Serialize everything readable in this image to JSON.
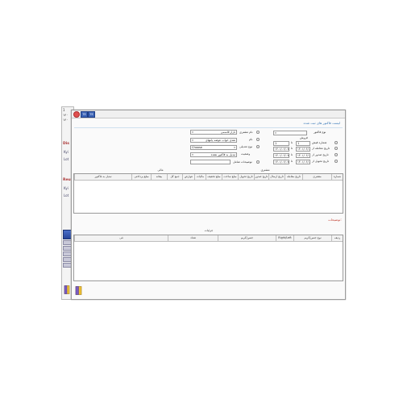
{
  "background_window": {
    "lines": [
      "1",
      "۱۴۰",
      "۱۴۰"
    ],
    "heading1": "Dis",
    "sub1a": "Kyi",
    "sub1b": "Lot",
    "heading2": "Reu",
    "sub2a": "Kyi",
    "sub2b": "Lot"
  },
  "titlebar": {
    "btn1": "TE",
    "btn2": "TE"
  },
  "window_title": "لیست فاکتور های ثبت شده",
  "filters": {
    "invoice_type_label": "نوع فاکتور",
    "invoice_type_value": "فروش",
    "invoice_number_label": "شماره فیش",
    "number_from": "1",
    "number_to": "1",
    "invoice_date_label": "تاریخ معامله از",
    "issue_date_label": "تاریخ صدور از",
    "delivery_date_label": "تاریخ تحویل از",
    "date_from": "۱۴۰۱/۰۶/۰۷",
    "date_to": "۱۴۰۱/۰۶/۰۷",
    "to_label": "تا",
    "customer_label": "نام مشتری",
    "customer_value": "بازار قاسمی",
    "name_label": "نام",
    "name_value": "نقدی خواب عوضه پایتهای",
    "payment_type_label": "نوع تعدیلی",
    "payment_type_value": "Choose",
    "status_label": "وضعیت",
    "status_value": "تبدیل به فاکتور نشده",
    "description_label": "توضیحات شامل",
    "description_value": ""
  },
  "main_table": {
    "group_customer": "مشتری",
    "group_financial": "مالی",
    "columns": [
      "شماره",
      "مشتری",
      "تاریخ معامله",
      "تاریخ ارسال",
      "تاریخ صدور",
      "تاریخ تحویل",
      "مبلغ ساخت",
      "مبلغ تخفیف",
      "مالیات",
      "عوارض",
      "جمع کل",
      "بیعانه",
      "مبلغ پرداختی",
      "تبدیل به فاکتور"
    ]
  },
  "notes_label": "توضیحات:",
  "details_table": {
    "title": "جزئیات",
    "columns": [
      "ردیف",
      "نوع جنس/کریم",
      "Right/Left",
      "جنس/کریم",
      "تعداد",
      "فی"
    ]
  }
}
